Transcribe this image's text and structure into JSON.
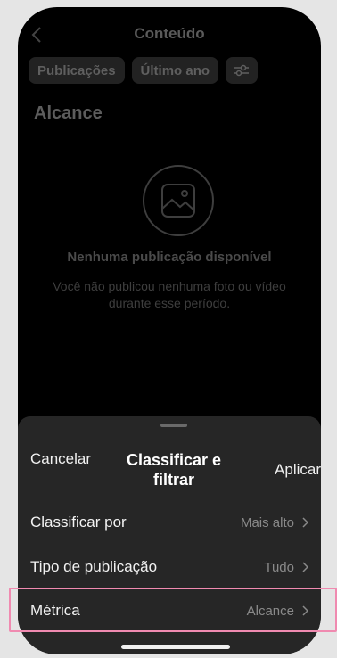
{
  "header": {
    "title": "Conteúdo"
  },
  "filters": {
    "chip_publications": "Publicações",
    "chip_period": "Último ano"
  },
  "section": {
    "title": "Alcance"
  },
  "empty_state": {
    "title": "Nenhuma publicação disponível",
    "description": "Você não publicou nenhuma foto ou vídeo durante esse período."
  },
  "sheet": {
    "cancel_label": "Cancelar",
    "title": "Classificar e filtrar",
    "apply_label": "Aplicar",
    "rows": [
      {
        "label": "Classificar por",
        "value": "Mais alto"
      },
      {
        "label": "Tipo de publicação",
        "value": "Tudo"
      },
      {
        "label": "Métrica",
        "value": "Alcance"
      }
    ]
  },
  "colors": {
    "highlight": "#f08ab0",
    "sheet_bg": "#262626"
  }
}
